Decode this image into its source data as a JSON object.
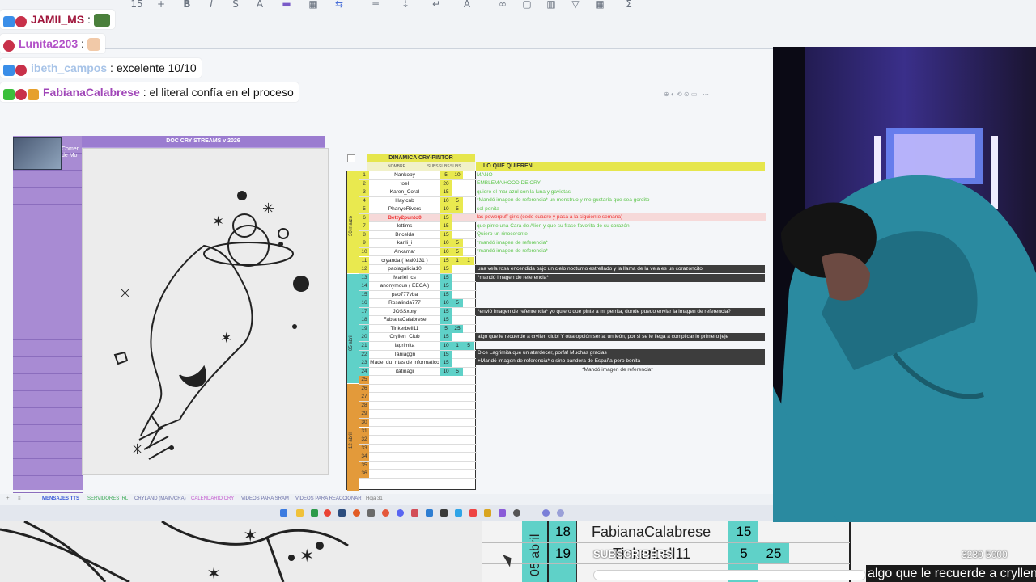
{
  "chat": [
    {
      "user": "JAMII_MS",
      "sep": " : ",
      "message": "",
      "emote": "car-emote",
      "user_color": "#a0163c"
    },
    {
      "user": "Lunita2203",
      "sep": " : ",
      "message": "",
      "emote": "hand-emote",
      "user_color": "#b352c8"
    },
    {
      "user": "ibeth_campos",
      "sep": " : ",
      "message": "excelente 10/10",
      "user_color": "#a8c4e8"
    },
    {
      "user": "FabianaCalabrese",
      "sep": " : ",
      "message": "el literal confía en el proceso",
      "user_color": "#a046b8"
    }
  ],
  "sheet": {
    "doc_title": "DOC CRY STREAMS v 2026",
    "comer_label": "Comer\nde Mo",
    "dyn_title": "DINAMICA CRY-PINTOR",
    "lo_quieren": "LO QUE QUIEREN",
    "col_heads": [
      "NOMBRE",
      "SUBS",
      "SUBS",
      "SUBS"
    ],
    "groups": [
      {
        "label": "30 marzo",
        "color": "#e9e94f"
      },
      {
        "label": "05 abril",
        "color": "#5fd1c8"
      },
      {
        "label": "12 abril",
        "color": "#e39a3a"
      }
    ],
    "rows": [
      {
        "n": "1",
        "name": "Nankoby",
        "s1": "5",
        "s2": "10",
        "s3": ""
      },
      {
        "n": "2",
        "name": "toeI",
        "s1": "20",
        "s2": "",
        "s3": ""
      },
      {
        "n": "3",
        "name": "Karen_Coral",
        "s1": "15",
        "s2": "",
        "s3": ""
      },
      {
        "n": "4",
        "name": "Haylcnb",
        "s1": "10",
        "s2": "5",
        "s3": ""
      },
      {
        "n": "5",
        "name": "PhanyeRivers",
        "s1": "10",
        "s2": "5",
        "s3": ""
      },
      {
        "n": "6",
        "name": "Betty2punto0",
        "s1": "15",
        "s2": "",
        "s3": "",
        "highlight": true
      },
      {
        "n": "7",
        "name": "lettims",
        "s1": "15",
        "s2": "",
        "s3": ""
      },
      {
        "n": "8",
        "name": "Bricelda",
        "s1": "15",
        "s2": "",
        "s3": ""
      },
      {
        "n": "9",
        "name": "karili_i",
        "s1": "10",
        "s2": "5",
        "s3": ""
      },
      {
        "n": "10",
        "name": "Ankamar",
        "s1": "10",
        "s2": "5",
        "s3": ""
      },
      {
        "n": "11",
        "name": "cryanda ( leal0131 )",
        "s1": "15",
        "s2": "1",
        "s3": "1"
      },
      {
        "n": "12",
        "name": "paolagalicia10",
        "s1": "15",
        "s2": "",
        "s3": ""
      },
      {
        "n": "13",
        "name": "Mariel_cs",
        "s1": "15",
        "s2": "",
        "s3": ""
      },
      {
        "n": "14",
        "name": "anonymous ( EECA )",
        "s1": "15",
        "s2": "",
        "s3": ""
      },
      {
        "n": "15",
        "name": "pao777vba",
        "s1": "15",
        "s2": "",
        "s3": ""
      },
      {
        "n": "16",
        "name": "Rosalinda777",
        "s1": "10",
        "s2": "5",
        "s3": ""
      },
      {
        "n": "17",
        "name": "JOSSxory",
        "s1": "15",
        "s2": "",
        "s3": ""
      },
      {
        "n": "18",
        "name": "FabianaCalabrese",
        "s1": "15",
        "s2": "",
        "s3": ""
      },
      {
        "n": "19",
        "name": "Tinkerbell11",
        "s1": "5",
        "s2": "25",
        "s3": ""
      },
      {
        "n": "20",
        "name": "Crylien_Club",
        "s1": "15",
        "s2": "",
        "s3": ""
      },
      {
        "n": "21",
        "name": "lagrimita",
        "s1": "10",
        "s2": "1",
        "s3": "5"
      },
      {
        "n": "22",
        "name": "Taniaggn",
        "s1": "15",
        "s2": "",
        "s3": ""
      },
      {
        "n": "23",
        "name": "Made_du_ritas de informatico",
        "s1": "15",
        "s2": "",
        "s3": ""
      },
      {
        "n": "24",
        "name": "itatinagi",
        "s1": "10",
        "s2": "5",
        "s3": ""
      },
      {
        "n": "25",
        "name": "",
        "s1": "",
        "s2": "",
        "s3": ""
      },
      {
        "n": "26",
        "name": "",
        "s1": "",
        "s2": "",
        "s3": ""
      },
      {
        "n": "27",
        "name": "",
        "s1": "",
        "s2": "",
        "s3": ""
      },
      {
        "n": "28",
        "name": "",
        "s1": "",
        "s2": "",
        "s3": ""
      },
      {
        "n": "29",
        "name": "",
        "s1": "",
        "s2": "",
        "s3": ""
      },
      {
        "n": "30",
        "name": "",
        "s1": "",
        "s2": "",
        "s3": ""
      },
      {
        "n": "31",
        "name": "",
        "s1": "",
        "s2": "",
        "s3": ""
      },
      {
        "n": "32",
        "name": "",
        "s1": "",
        "s2": "",
        "s3": ""
      },
      {
        "n": "33",
        "name": "",
        "s1": "",
        "s2": "",
        "s3": ""
      },
      {
        "n": "34",
        "name": "",
        "s1": "",
        "s2": "",
        "s3": ""
      },
      {
        "n": "35",
        "name": "",
        "s1": "",
        "s2": "",
        "s3": ""
      },
      {
        "n": "36",
        "name": "",
        "s1": "",
        "s2": "",
        "s3": ""
      }
    ],
    "requests": [
      {
        "text": "MANO",
        "style": "green"
      },
      {
        "text": "EMBLEMA HOOD DE CRY",
        "style": "green"
      },
      {
        "text": "quiero el mar azul con la luna y gaviotas",
        "style": "green"
      },
      {
        "text": "*Mandó imagen de referencia* un monstruo y me gustaría que sea gordito",
        "style": "green"
      },
      {
        "text": "sol penita",
        "style": "green"
      },
      {
        "text": "las powerpuff girls   (cede cuadro y pasa a la siguiente semana)",
        "style": "red"
      },
      {
        "text": "que pinte una Cara de Alien y que su frase favorita de su corazón",
        "style": "green"
      },
      {
        "text": "Quiero un rinoceronte",
        "style": "green"
      },
      {
        "text": "*mandó imagen de referencia*",
        "style": "green"
      },
      {
        "text": "*mandó imagen de referencia*",
        "style": "green"
      },
      {
        "text": "una vela rosa encendida bajo un cielo nocturno estrellado y la llama de la vela es un corazoncito",
        "style": "dark"
      },
      {
        "text": "*mandó imagen de referencia*",
        "style": "dark"
      },
      {
        "text": "*envió imagen de refenrencia* yo quiero que pinte a mi perrita, donde puedo enviar la imagen de referencia?",
        "style": "dark"
      },
      {
        "text": "algo que le recuerde a cryllen club! Y otra opción sería: un león, por si se le llega a complicar lo primero jeje",
        "style": "dark"
      },
      {
        "text": "Dice Lagrimita que un atardecer, porfa! Muchas gracias",
        "style": "dark"
      },
      {
        "text": "+Mandó imagen de referencia* o sino bandera de España pero bonita",
        "style": "dark"
      },
      {
        "text": "*Mandó imagen de referencia*",
        "style": "plain"
      }
    ],
    "tabs": [
      "MENSAJES TTS",
      "SERVIDORES IRL",
      "CRYLAND (MAIN/CRA)",
      "CALENDARIO CRY",
      "VIDEOS PARA SRAM",
      "VIDEOS PARA REACCIONAR",
      "Hoja 31"
    ]
  },
  "zoom": {
    "group_label": "05 abril",
    "rows": [
      {
        "n": "18",
        "name": "FabianaCalabrese",
        "s1": "15",
        "s2": ""
      },
      {
        "n": "19",
        "name": "Tinkerbell11",
        "s1": "5",
        "s2": "25"
      }
    ]
  },
  "overlay": {
    "sub_label": "SUBSCRIBERS",
    "sub_count": "3230  5000",
    "sub_progress": 0.646,
    "ticker": "algo que le recuerde a cryllen club!"
  },
  "colors": {
    "accent_purple": "#a88bd3",
    "yellow_header": "#e6e64d",
    "teal_group": "#5fd1c8",
    "orange_group": "#e39a3a"
  }
}
